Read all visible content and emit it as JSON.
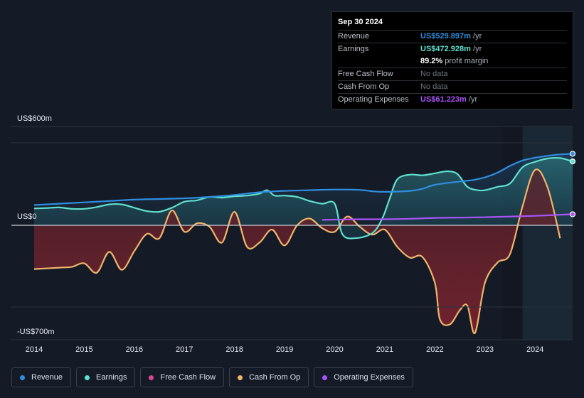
{
  "tooltip": {
    "date": "Sep 30 2024",
    "rows": {
      "revenue": {
        "label": "Revenue",
        "value": "US$529.897m",
        "unit": " /yr"
      },
      "earnings": {
        "label": "Earnings",
        "value": "US$472.928m",
        "unit": " /yr"
      },
      "margin": {
        "value": "89.2%",
        "text": " profit margin"
      },
      "fcf": {
        "label": "Free Cash Flow",
        "value": "No data"
      },
      "cfo": {
        "label": "Cash From Op",
        "value": "No data"
      },
      "opex": {
        "label": "Operating Expenses",
        "value": "US$61.223m",
        "unit": " /yr"
      }
    }
  },
  "legend": [
    {
      "label": "Revenue",
      "color": "#2f8ee0"
    },
    {
      "label": "Earnings",
      "color": "#5fe0cf"
    },
    {
      "label": "Free Cash Flow",
      "color": "#d9478c"
    },
    {
      "label": "Cash From Op",
      "color": "#f0b46b"
    },
    {
      "label": "Operating Expenses",
      "color": "#a855f7"
    }
  ],
  "chart_data": {
    "type": "area",
    "unit": "US$m",
    "y_tick_labels": {
      "top": "US$600m",
      "zero": "US$0",
      "bottom": "-US$700m"
    },
    "ylim": [
      -700,
      600
    ],
    "x_tick_labels": [
      "2014",
      "2015",
      "2016",
      "2017",
      "2018",
      "2019",
      "2020",
      "2021",
      "2022",
      "2023",
      "2024"
    ],
    "xlim": [
      2014.0,
      2024.75
    ],
    "forecast_shade_from": 2023.75,
    "series": [
      {
        "name": "Revenue",
        "color": "#2f8ee0",
        "points": [
          [
            2014.0,
            150
          ],
          [
            2014.5,
            160
          ],
          [
            2015.0,
            170
          ],
          [
            2015.5,
            180
          ],
          [
            2016.0,
            190
          ],
          [
            2016.5,
            195
          ],
          [
            2017.0,
            200
          ],
          [
            2017.5,
            210
          ],
          [
            2018.0,
            225
          ],
          [
            2018.5,
            245
          ],
          [
            2019.0,
            255
          ],
          [
            2019.5,
            260
          ],
          [
            2020.0,
            265
          ],
          [
            2020.5,
            262
          ],
          [
            2020.75,
            252
          ],
          [
            2021.0,
            248
          ],
          [
            2021.5,
            255
          ],
          [
            2021.75,
            270
          ],
          [
            2022.0,
            300
          ],
          [
            2022.5,
            325
          ],
          [
            2022.75,
            335
          ],
          [
            2023.0,
            355
          ],
          [
            2023.25,
            390
          ],
          [
            2023.5,
            440
          ],
          [
            2023.75,
            480
          ],
          [
            2024.0,
            500
          ],
          [
            2024.25,
            515
          ],
          [
            2024.5,
            525
          ],
          [
            2024.75,
            530
          ]
        ]
      },
      {
        "name": "Earnings",
        "color": "#5fe0cf",
        "points": [
          [
            2014.0,
            125
          ],
          [
            2014.25,
            128
          ],
          [
            2014.5,
            132
          ],
          [
            2014.75,
            122
          ],
          [
            2015.0,
            122
          ],
          [
            2015.25,
            135
          ],
          [
            2015.5,
            155
          ],
          [
            2015.75,
            155
          ],
          [
            2016.0,
            130
          ],
          [
            2016.25,
            105
          ],
          [
            2016.5,
            100
          ],
          [
            2016.75,
            130
          ],
          [
            2017.0,
            175
          ],
          [
            2017.25,
            185
          ],
          [
            2017.5,
            210
          ],
          [
            2017.75,
            205
          ],
          [
            2018.0,
            215
          ],
          [
            2018.25,
            220
          ],
          [
            2018.5,
            235
          ],
          [
            2018.65,
            260
          ],
          [
            2018.8,
            220
          ],
          [
            2019.0,
            220
          ],
          [
            2019.25,
            210
          ],
          [
            2019.5,
            180
          ],
          [
            2019.75,
            160
          ],
          [
            2020.0,
            160
          ],
          [
            2020.15,
            -60
          ],
          [
            2020.4,
            -90
          ],
          [
            2020.75,
            -55
          ],
          [
            2020.95,
            50
          ],
          [
            2021.1,
            200
          ],
          [
            2021.25,
            340
          ],
          [
            2021.5,
            375
          ],
          [
            2021.75,
            370
          ],
          [
            2022.0,
            385
          ],
          [
            2022.25,
            400
          ],
          [
            2022.45,
            380
          ],
          [
            2022.65,
            285
          ],
          [
            2022.85,
            260
          ],
          [
            2023.0,
            260
          ],
          [
            2023.25,
            285
          ],
          [
            2023.5,
            310
          ],
          [
            2023.75,
            430
          ],
          [
            2024.0,
            470
          ],
          [
            2024.25,
            495
          ],
          [
            2024.5,
            498
          ],
          [
            2024.75,
            473
          ]
        ]
      },
      {
        "name": "Cash From Op",
        "color": "#f0b46b",
        "points": [
          [
            2014.0,
            -305
          ],
          [
            2014.5,
            -295
          ],
          [
            2014.75,
            -290
          ],
          [
            2015.0,
            -265
          ],
          [
            2015.25,
            -330
          ],
          [
            2015.5,
            -185
          ],
          [
            2015.75,
            -310
          ],
          [
            2016.0,
            -180
          ],
          [
            2016.25,
            -60
          ],
          [
            2016.5,
            -90
          ],
          [
            2016.75,
            110
          ],
          [
            2017.0,
            -45
          ],
          [
            2017.25,
            15
          ],
          [
            2017.5,
            -10
          ],
          [
            2017.75,
            -120
          ],
          [
            2018.0,
            100
          ],
          [
            2018.25,
            -150
          ],
          [
            2018.5,
            -120
          ],
          [
            2018.75,
            -30
          ],
          [
            2019.0,
            -140
          ],
          [
            2019.25,
            0
          ],
          [
            2019.5,
            50
          ],
          [
            2019.75,
            -20
          ],
          [
            2020.0,
            -45
          ],
          [
            2020.25,
            65
          ],
          [
            2020.5,
            -10
          ],
          [
            2020.75,
            -65
          ],
          [
            2021.0,
            -30
          ],
          [
            2021.25,
            -150
          ],
          [
            2021.5,
            -225
          ],
          [
            2021.75,
            -220
          ],
          [
            2022.0,
            -400
          ],
          [
            2022.1,
            -655
          ],
          [
            2022.3,
            -690
          ],
          [
            2022.5,
            -590
          ],
          [
            2022.65,
            -560
          ],
          [
            2022.8,
            -750
          ],
          [
            2023.0,
            -400
          ],
          [
            2023.25,
            -260
          ],
          [
            2023.5,
            -200
          ],
          [
            2023.75,
            140
          ],
          [
            2024.0,
            410
          ],
          [
            2024.25,
            280
          ],
          [
            2024.5,
            -90
          ]
        ]
      },
      {
        "name": "Operating Expenses",
        "color": "#a855f7",
        "points": [
          [
            2019.75,
            40
          ],
          [
            2020.0,
            42
          ],
          [
            2020.5,
            45
          ],
          [
            2021.0,
            45
          ],
          [
            2021.5,
            48
          ],
          [
            2022.0,
            55
          ],
          [
            2022.5,
            57
          ],
          [
            2023.0,
            60
          ],
          [
            2023.5,
            65
          ],
          [
            2024.0,
            70
          ],
          [
            2024.75,
            82
          ]
        ]
      }
    ]
  }
}
